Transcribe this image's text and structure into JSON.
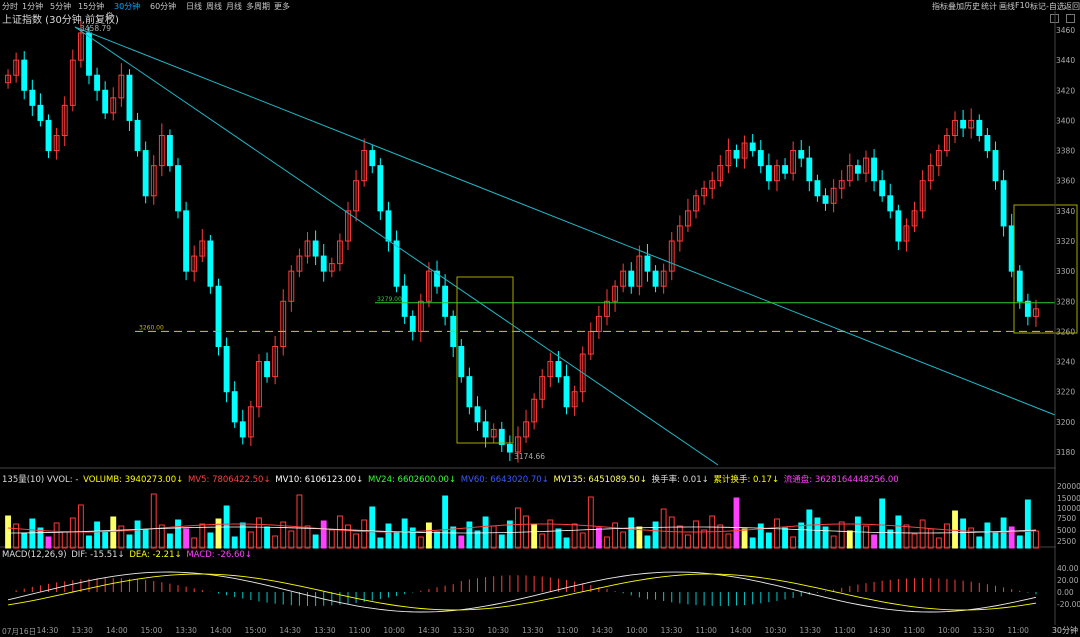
{
  "toolbar": {
    "periods": [
      "分时",
      "1分钟",
      "5分钟",
      "15分钟",
      "30分钟",
      "60分钟",
      "日线",
      "周线",
      "月线",
      "多周期",
      "更多"
    ],
    "active_period": "30分钟",
    "right_tools": [
      "指标",
      "叠加",
      "历史",
      "统计",
      "画线",
      "F10",
      "标记",
      "-自选",
      "返回"
    ]
  },
  "chart_title": "上证指数 (30分钟,前复权)",
  "colors": {
    "up": "#ff3c3c",
    "down": "#00ffff",
    "trend": "#21b8c8",
    "support": "#c8b400",
    "green_line": "#33cc33",
    "box": "#a8a800"
  },
  "price_axis": [
    "3460",
    "3440",
    "3420",
    "3400",
    "3380",
    "3360",
    "3340",
    "3320",
    "3300",
    "3280",
    "3260",
    "3240",
    "3220",
    "3200",
    "3180"
  ],
  "price_range": [
    3160,
    3470
  ],
  "price_annotations": {
    "high": "3458.79",
    "low": "3174.66",
    "level_a": "3260.00",
    "level_b": "3279.00"
  },
  "volume_legend": {
    "name": "135量(10) VVOL: -",
    "volumb": "VOLUMB: 3940273.00↓",
    "mv5": "MV5: 7806422.50↓",
    "mv10": "MV10: 6106123.00↓",
    "mv24": "MV24: 6602600.00↓",
    "mv60": "MV60: 6643020.70↓",
    "mv135": "MV135: 6451089.50↓",
    "turnover": "换手率: 0.01↓",
    "cum_turnover": "累计换手: 0.17↓",
    "float_cap": "流通盘: 3628164448256.00"
  },
  "volume_axis": [
    "20000",
    "15000",
    "10000",
    "7500",
    "5000",
    "2500"
  ],
  "macd_legend": {
    "name": "MACD(12,26,9)",
    "dif": "DIF: -15.51↓",
    "dea": "DEA: -2.21↓",
    "macd": "MACD: -26.60↓"
  },
  "macd_axis": [
    "40.00",
    "20.00",
    "0.00",
    "-20.00"
  ],
  "time_axis": [
    "07月16日",
    "14:30",
    "13:30",
    "14:00",
    "15:00",
    "13:30",
    "14:00",
    "15:00",
    "14:30",
    "13:30",
    "11:00",
    "10:00",
    "14:30",
    "13:30",
    "10:30",
    "13:30",
    "11:00",
    "14:30",
    "10:00",
    "13:30",
    "11:00",
    "14:00",
    "10:30",
    "13:30",
    "11:00",
    "14:30",
    "11:00",
    "10:00",
    "13:30",
    "11:00"
  ],
  "period_label": "30分钟"
}
